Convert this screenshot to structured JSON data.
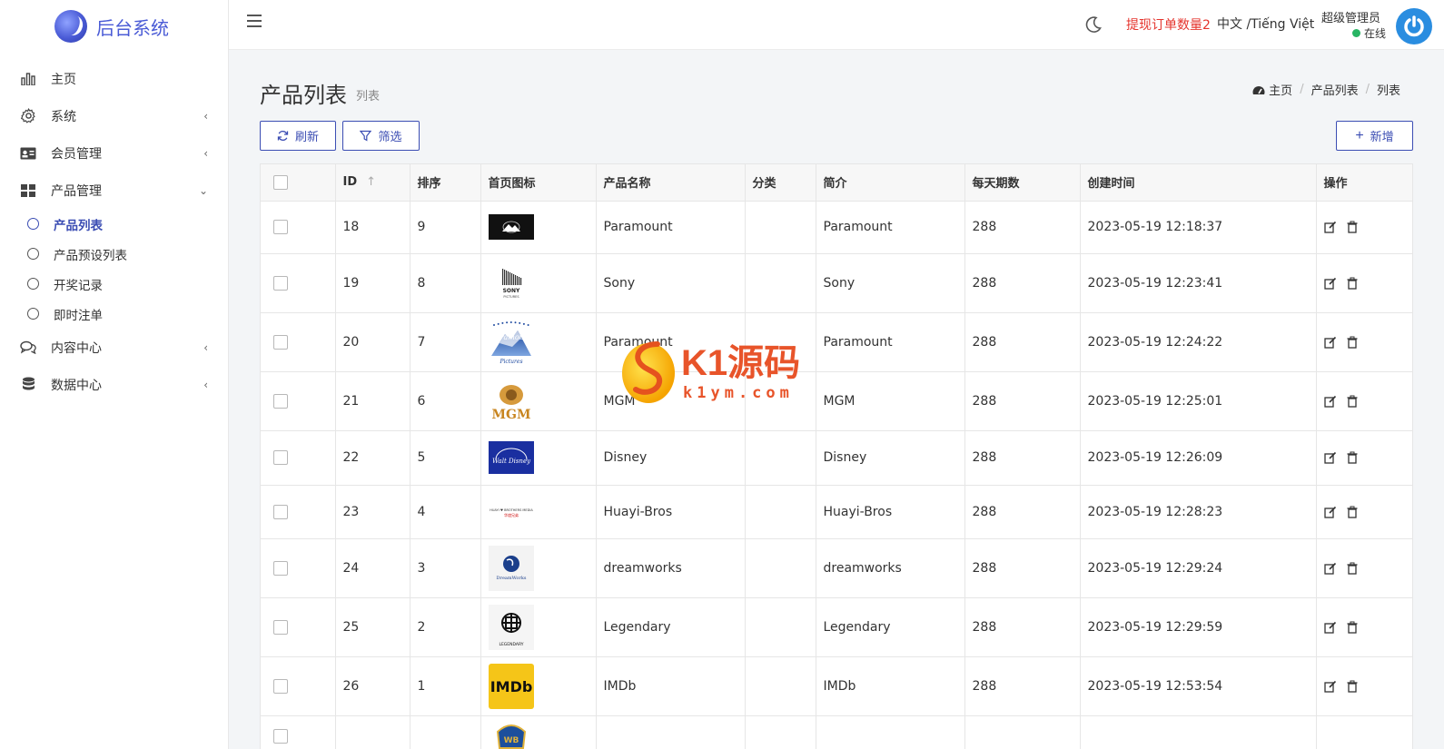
{
  "app": {
    "title": "后台系统"
  },
  "sidebar": {
    "items": [
      {
        "label": "主页",
        "icon": "bar-chart-icon",
        "arrow": ""
      },
      {
        "label": "系统",
        "icon": "gear-icon",
        "arrow": "‹"
      },
      {
        "label": "会员管理",
        "icon": "id-card-icon",
        "arrow": "‹"
      },
      {
        "label": "产品管理",
        "icon": "grid-icon",
        "arrow": "⌄"
      },
      {
        "label": "内容中心",
        "icon": "chat-icon",
        "arrow": "‹"
      },
      {
        "label": "数据中心",
        "icon": "database-icon",
        "arrow": "‹"
      }
    ],
    "submenu": [
      {
        "label": "产品列表",
        "active": true
      },
      {
        "label": "产品预设列表",
        "active": false
      },
      {
        "label": "开奖记录",
        "active": false
      },
      {
        "label": "即时注单",
        "active": false
      }
    ]
  },
  "topbar": {
    "withdraw_label": "提现订单数量2",
    "lang_label": "中文 /Tiếng Việt",
    "admin_name": "超级管理员",
    "admin_status": "在线"
  },
  "page": {
    "title": "产品列表",
    "subtitle": "列表",
    "breadcrumb": [
      "主页",
      "产品列表",
      "列表"
    ]
  },
  "toolbar": {
    "refresh_label": "刷新",
    "filter_label": "筛选",
    "add_label": "新增"
  },
  "table": {
    "headers": [
      "ID",
      "排序",
      "首页图标",
      "产品名称",
      "分类",
      "简介",
      "每天期数",
      "创建时间",
      "操作"
    ],
    "rows": [
      {
        "id": "18",
        "sort": "9",
        "logo": "paramount-black-logo",
        "name": "Paramount",
        "category": "",
        "intro": "Paramount",
        "daily": "288",
        "created": "2023-05-19 12:18:37"
      },
      {
        "id": "19",
        "sort": "8",
        "logo": "sony-pictures-logo",
        "name": "Sony",
        "category": "",
        "intro": "Sony",
        "daily": "288",
        "created": "2023-05-19 12:23:41"
      },
      {
        "id": "20",
        "sort": "7",
        "logo": "paramount-mountain-logo",
        "name": "Paramount",
        "category": "",
        "intro": "Paramount",
        "daily": "288",
        "created": "2023-05-19 12:24:22"
      },
      {
        "id": "21",
        "sort": "6",
        "logo": "mgm-logo",
        "name": "MGM",
        "category": "",
        "intro": "MGM",
        "daily": "288",
        "created": "2023-05-19 12:25:01"
      },
      {
        "id": "22",
        "sort": "5",
        "logo": "disney-logo",
        "name": "Disney",
        "category": "",
        "intro": "Disney",
        "daily": "288",
        "created": "2023-05-19 12:26:09"
      },
      {
        "id": "23",
        "sort": "4",
        "logo": "huayi-bros-logo",
        "name": "Huayi-Bros",
        "category": "",
        "intro": "Huayi-Bros",
        "daily": "288",
        "created": "2023-05-19 12:28:23"
      },
      {
        "id": "24",
        "sort": "3",
        "logo": "dreamworks-logo",
        "name": "dreamworks",
        "category": "",
        "intro": "dreamworks",
        "daily": "288",
        "created": "2023-05-19 12:29:24"
      },
      {
        "id": "25",
        "sort": "2",
        "logo": "legendary-logo",
        "name": "Legendary",
        "category": "",
        "intro": "Legendary",
        "daily": "288",
        "created": "2023-05-19 12:29:59"
      },
      {
        "id": "26",
        "sort": "1",
        "logo": "imdb-logo",
        "name": "IMDb",
        "category": "",
        "intro": "IMDb",
        "daily": "288",
        "created": "2023-05-19 12:53:54"
      },
      {
        "id": "",
        "sort": "",
        "logo": "warner-bros-logo",
        "name": "",
        "category": "",
        "intro": "",
        "daily": "",
        "created": ""
      }
    ],
    "row_heights": []
  },
  "watermark": {
    "brand": "K1源码",
    "url": "k1ym.com"
  },
  "colors": {
    "accent": "#3b4db3",
    "danger": "#e5342d",
    "online": "#28b463"
  }
}
